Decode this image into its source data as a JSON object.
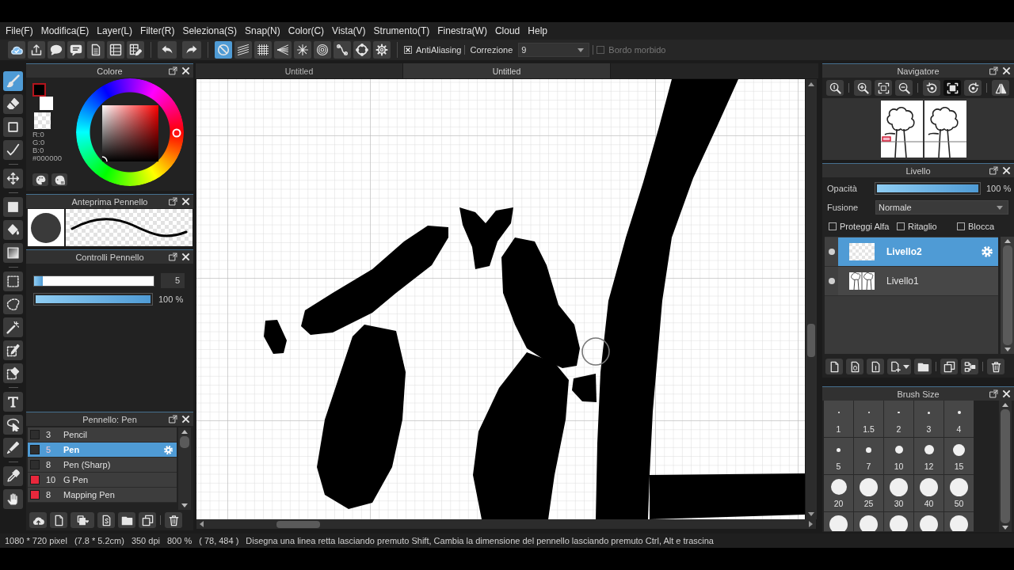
{
  "menu": [
    "File(F)",
    "Modifica(E)",
    "Layer(L)",
    "Filter(R)",
    "Seleziona(S)",
    "Snap(N)",
    "Color(C)",
    "Vista(V)",
    "Strumento(T)",
    "Finestra(W)",
    "Cloud",
    "Help"
  ],
  "toolbar": {
    "snap_buttons": [
      {
        "selected": true
      },
      {
        "selected": false
      },
      {
        "selected": false
      },
      {
        "selected": false
      },
      {
        "selected": false
      },
      {
        "selected": false
      },
      {
        "selected": false
      },
      {
        "selected": false
      },
      {
        "selected": false
      }
    ],
    "antialiasing": {
      "label": "AntiAliasing",
      "checked": true
    },
    "correction": {
      "label": "Correzione",
      "value": "9"
    },
    "soft_edge": {
      "label": "Bordo morbido",
      "checked": false,
      "disabled": true
    }
  },
  "tool_groups": [
    {
      "tools": [
        {
          "selected": true
        },
        {
          "selected": false
        },
        {
          "selected": false
        },
        {
          "selected": false
        }
      ]
    },
    {
      "tools": [
        {
          "selected": false
        }
      ]
    },
    {
      "tools": [
        {
          "selected": false
        },
        {
          "selected": false
        },
        {
          "selected": false
        }
      ]
    },
    {
      "tools": [
        {
          "selected": false
        },
        {
          "selected": false
        },
        {
          "selected": false
        },
        {
          "selected": false
        },
        {
          "selected": false
        }
      ]
    },
    {
      "tools": [
        {
          "selected": false
        },
        {
          "selected": false
        },
        {
          "selected": false
        }
      ]
    },
    {
      "tools": [
        {
          "selected": false
        },
        {
          "selected": false
        }
      ]
    }
  ],
  "color_panel": {
    "title": "Colore",
    "swatches": [
      {
        "kind": "solid",
        "color": "#000000",
        "selected": true
      },
      {
        "kind": "solid",
        "color": "#ffffff",
        "selected": false
      },
      {
        "kind": "transparent",
        "selected": false
      }
    ],
    "values": [
      "R:0",
      "G:0",
      "B:0",
      "#000000"
    ]
  },
  "brush_preview": {
    "title": "Anteprima Pennello"
  },
  "brush_controls": {
    "title": "Controlli Pennello",
    "size": {
      "level": 0.07,
      "value": "5"
    },
    "opacity": {
      "level": 1,
      "reading": "100 %"
    }
  },
  "brush_list": {
    "title": "Pennello: Pen",
    "items": [
      {
        "color": "#2e2e2e",
        "size": "3",
        "name": "Pencil",
        "selected": false
      },
      {
        "color": "#2e2e2e",
        "size": "5",
        "name": "Pen",
        "selected": true
      },
      {
        "color": "#2e2e2e",
        "size": "8",
        "name": "Pen (Sharp)",
        "selected": false
      },
      {
        "color": "#e8283c",
        "size": "10",
        "name": "G Pen",
        "selected": false
      },
      {
        "color": "#e8283c",
        "size": "8",
        "name": "Mapping Pen",
        "selected": false
      }
    ]
  },
  "document": {
    "tabs": [
      {
        "title": "Untitled",
        "selected": false
      },
      {
        "title": "Untitled",
        "selected": true
      }
    ]
  },
  "navigator": {
    "title": "Navigatore",
    "button_groups": [
      {
        "buttons": [
          {
            "selected": false
          }
        ]
      },
      {
        "buttons": [
          {
            "selected": false
          },
          {
            "selected": false
          },
          {
            "selected": false
          }
        ]
      },
      {
        "buttons": [
          {
            "selected": false
          },
          {
            "selected": true
          },
          {
            "selected": false
          }
        ]
      },
      {
        "buttons": [
          {
            "selected": false
          }
        ]
      }
    ]
  },
  "layer_panel": {
    "title": "Livello",
    "opacity": {
      "label": "Opacità",
      "level": 1,
      "reading": "100 %"
    },
    "blend": {
      "label": "Fusione",
      "value": "Normale"
    },
    "options": [
      {
        "label": "Proteggi Alfa",
        "checked": false
      },
      {
        "label": "Ritaglio",
        "checked": false
      },
      {
        "label": "Blocca",
        "checked": false
      }
    ],
    "layers": [
      {
        "name": "Livello2",
        "kind": "empty",
        "selected": true
      },
      {
        "name": "Livello1",
        "kind": "sketch",
        "selected": false
      }
    ]
  },
  "brush_size_panel": {
    "title": "Brush Size",
    "sizes": [
      "1",
      "1.5",
      "2",
      "3",
      "4",
      "5",
      "7",
      "10",
      "12",
      "15",
      "20",
      "25",
      "30",
      "40",
      "50"
    ],
    "overflow_row": true
  },
  "status_bar": [
    "1080 * 720 pixel",
    "(7.8 * 5.2cm)",
    "350 dpi",
    "800 %",
    "( 78, 484 )",
    "Disegna una linea retta lasciando premuto Shift, Cambia la dimensione del pennello lasciando premuto Ctrl, Alt e trascina"
  ]
}
